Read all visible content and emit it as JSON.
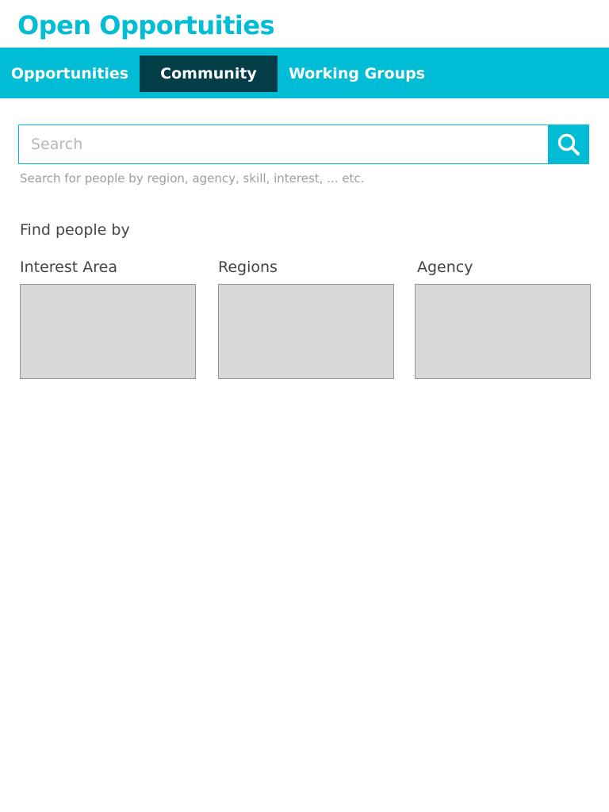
{
  "header": {
    "title": "Open Opportuities"
  },
  "nav": {
    "tabs": [
      {
        "label": "Opportunities",
        "active": false
      },
      {
        "label": "Community",
        "active": true
      },
      {
        "label": "Working Groups",
        "active": false
      }
    ]
  },
  "search": {
    "placeholder": "Search",
    "value": "",
    "help_text": "Search for people by region, agency, skill, interest, ... etc.",
    "button_icon": "search-icon"
  },
  "find_people": {
    "heading": "Find people by",
    "categories": [
      {
        "label": "Interest Area"
      },
      {
        "label": "Regions"
      },
      {
        "label": "Agency"
      }
    ]
  },
  "colors": {
    "accent": "#00bcd4",
    "active_tab": "#033d48",
    "placeholder_box": "#d8d8d8"
  }
}
